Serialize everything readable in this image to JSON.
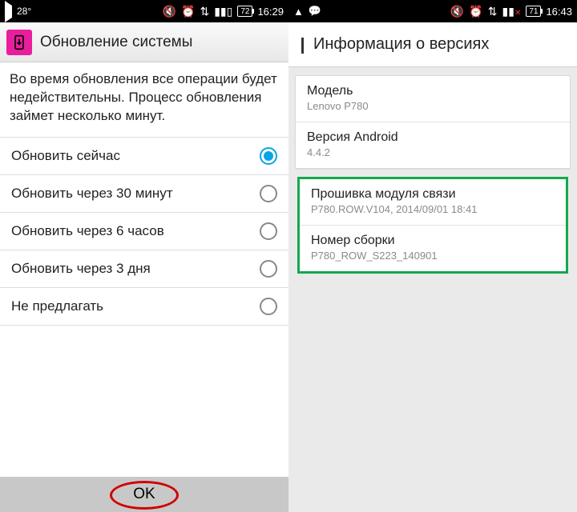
{
  "left": {
    "statusbar": {
      "temperature": "28°",
      "battery": "72",
      "time": "16:29"
    },
    "header": {
      "title": "Обновление системы"
    },
    "intro_text": "Во время обновления все операции будет недействительны. Процесс обновления займет несколько минут.",
    "options": [
      {
        "label": "Обновить сейчас",
        "selected": true
      },
      {
        "label": "Обновить через 30 минут",
        "selected": false
      },
      {
        "label": "Обновить через 6 часов",
        "selected": false
      },
      {
        "label": "Обновить через 3 дня",
        "selected": false
      },
      {
        "label": "Не предлагать",
        "selected": false
      }
    ],
    "ok_label": "OK"
  },
  "right": {
    "statusbar": {
      "battery": "71",
      "time": "16:43"
    },
    "header": {
      "title": "Информация о версиях"
    },
    "rows": [
      {
        "primary": "Модель",
        "secondary": "Lenovo P780"
      },
      {
        "primary": "Версия Android",
        "secondary": "4.4.2"
      },
      {
        "primary": "Прошивка модуля связи",
        "secondary": "P780.ROW.V104, 2014/09/01 18:41"
      },
      {
        "primary": "Номер сборки",
        "secondary": "P780_ROW_S223_140901"
      }
    ]
  }
}
